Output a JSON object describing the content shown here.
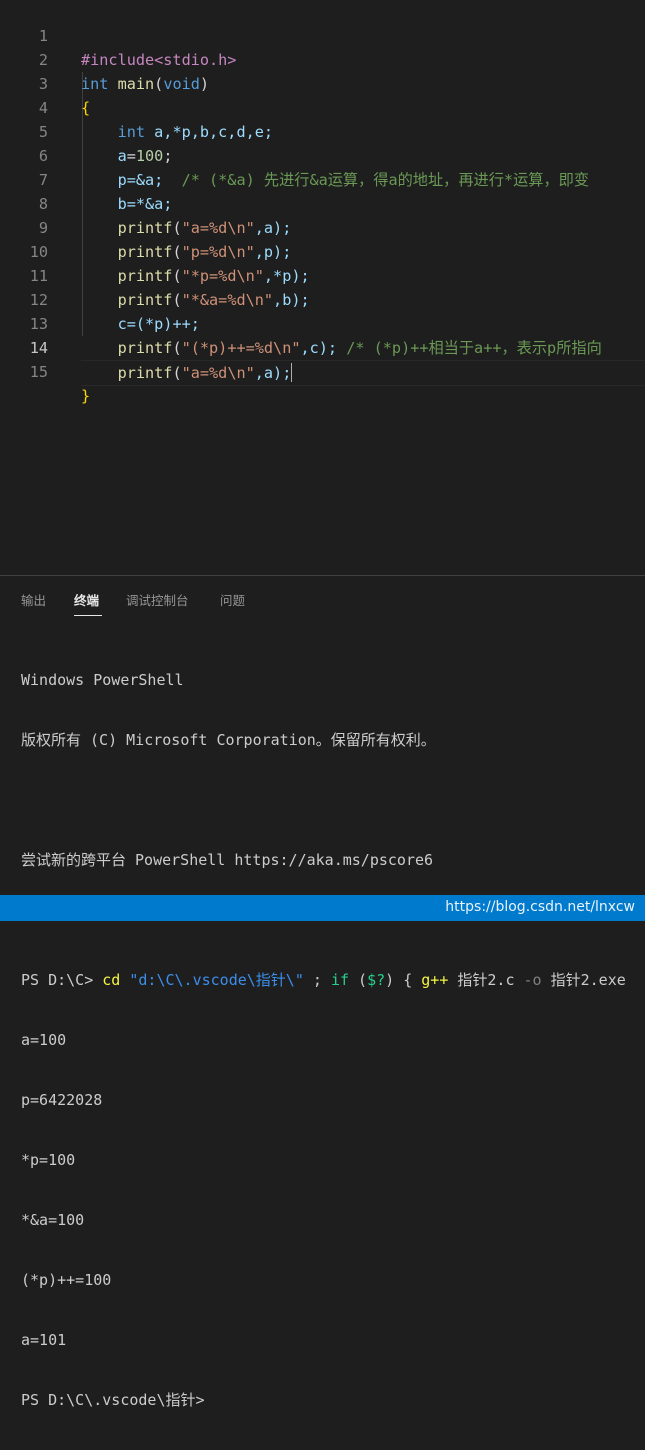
{
  "editor": {
    "line_numbers": [
      "1",
      "2",
      "3",
      "4",
      "5",
      "6",
      "7",
      "8",
      "9",
      "10",
      "11",
      "12",
      "13",
      "14",
      "15"
    ],
    "active_line": "14",
    "lines": {
      "l1": {
        "pre": "#include<stdio.h>"
      },
      "l2": {
        "type": "int",
        "sp": " ",
        "fn": "main",
        "open": "(",
        "void": "void",
        "close": ")"
      },
      "l3": {
        "brace": "{"
      },
      "l4": {
        "type": "int",
        "rest": " a,*p,b,c,d,e;"
      },
      "l5": {
        "a": "a",
        "eq": "=",
        "num": "100",
        "semi": ";"
      },
      "l6": {
        "code": "p=&a;",
        "comment": "  /* (*&a) 先进行&a运算，得a的地址，再进行*运算，即变"
      },
      "l7": {
        "code": "b=*&a;"
      },
      "l8": {
        "fn": "printf",
        "open": "(",
        "str": "\"a=%d\\n\"",
        "rest": ",a);"
      },
      "l9": {
        "fn": "printf",
        "open": "(",
        "str": "\"p=%d\\n\"",
        "rest": ",p);"
      },
      "l10": {
        "fn": "printf",
        "open": "(",
        "str": "\"*p=%d\\n\"",
        "rest": ",*p);"
      },
      "l11": {
        "fn": "printf",
        "open": "(",
        "str": "\"*&a=%d\\n\"",
        "rest": ",b);"
      },
      "l12": {
        "code": "c=(*p)++;"
      },
      "l13": {
        "fn": "printf",
        "open": "(",
        "str": "\"(*p)++=%d\\n\"",
        "rest": ",c);",
        "comment": " /* (*p)++相当于a++，表示p所指向"
      },
      "l14": {
        "fn": "printf",
        "open": "(",
        "str": "\"a=%d\\n\"",
        "rest": ",a);"
      },
      "l15": {
        "brace": "}"
      }
    }
  },
  "panel": {
    "tabs": [
      "输出",
      "终端",
      "调试控制台",
      "问题"
    ],
    "active_tab": "终端",
    "terminal": {
      "header1": "Windows PowerShell",
      "header2": "版权所有 (C) Microsoft Corporation。保留所有权利。",
      "header3": "尝试新的跨平台 PowerShell https://aka.ms/pscore6",
      "prompt1": "PS D:\\C> ",
      "cmd_cd": "cd",
      "cmd_path": " \"d:\\C\\.vscode\\指针\\\"",
      "cmd_semi1": " ; ",
      "cmd_if": "if",
      "cmd_cond_open": " (",
      "cmd_cond": "$?",
      "cmd_cond_close": ") { ",
      "cmd_gpp": "g++",
      "cmd_file": " 指针2.c ",
      "cmd_flag": "-o",
      "cmd_out": " 指针2.exe",
      "outputs": [
        "a=100",
        "p=6422028",
        "*p=100",
        "*&a=100",
        "(*p)++=100",
        "a=101"
      ],
      "prompt2": "PS D:\\C\\.vscode\\指针>"
    }
  },
  "status": {
    "watermark": "https://blog.csdn.net/lnxcw",
    "color": "#007acc"
  }
}
